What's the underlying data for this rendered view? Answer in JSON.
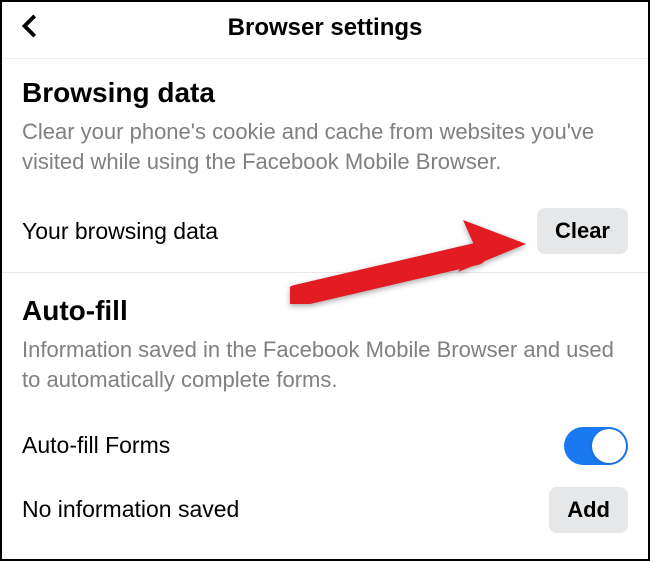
{
  "header": {
    "title": "Browser settings"
  },
  "browsing_data": {
    "title": "Browsing data",
    "description": "Clear your phone's cookie and cache from websites you've visited while using the Facebook Mobile Browser.",
    "row_label": "Your browsing data",
    "clear_button": "Clear"
  },
  "autofill": {
    "title": "Auto-fill",
    "description": "Information saved in the Facebook Mobile Browser and used to automatically complete forms.",
    "forms_label": "Auto-fill Forms",
    "forms_enabled": true,
    "no_info_label": "No information saved",
    "add_button": "Add"
  }
}
